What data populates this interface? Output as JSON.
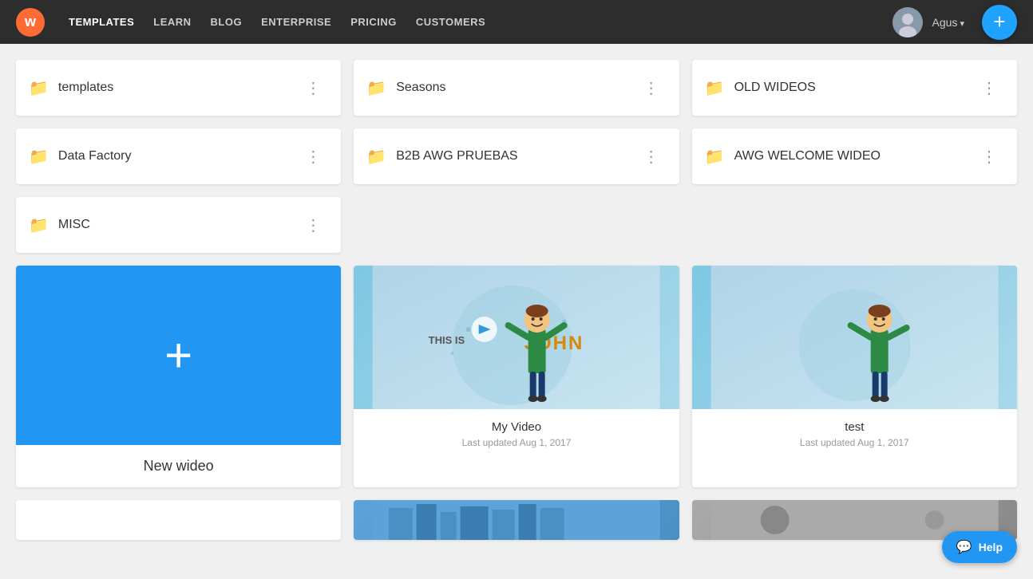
{
  "navbar": {
    "logo_text": "w",
    "links": [
      {
        "label": "TEMPLATES",
        "active": true
      },
      {
        "label": "LEARN",
        "active": false
      },
      {
        "label": "BLOG",
        "active": false
      },
      {
        "label": "ENTERPRISE",
        "active": false
      },
      {
        "label": "PRICING",
        "active": false
      },
      {
        "label": "CUSTOMERS",
        "active": false
      }
    ],
    "user_name": "Agus",
    "fab_label": "+"
  },
  "folders": [
    {
      "name": "templates"
    },
    {
      "name": "Seasons"
    },
    {
      "name": "OLD WIDEOS"
    },
    {
      "name": "Data Factory"
    },
    {
      "name": "B2B AWG PRUEBAS"
    },
    {
      "name": "AWG WELCOME WIDEO"
    },
    {
      "name": "MISC"
    }
  ],
  "new_wideo": {
    "label": "New wideo"
  },
  "videos": [
    {
      "title": "My Video",
      "updated": "Last updated Aug 1, 2017",
      "type": "john"
    },
    {
      "title": "test",
      "updated": "Last updated Aug 1, 2017",
      "type": "john2"
    }
  ],
  "partial_cards": [
    {
      "type": "white"
    },
    {
      "type": "city"
    },
    {
      "type": "photo"
    }
  ],
  "help": {
    "label": "Help"
  },
  "colors": {
    "accent_blue": "#2196f3",
    "nav_bg": "#2d2d2d"
  }
}
